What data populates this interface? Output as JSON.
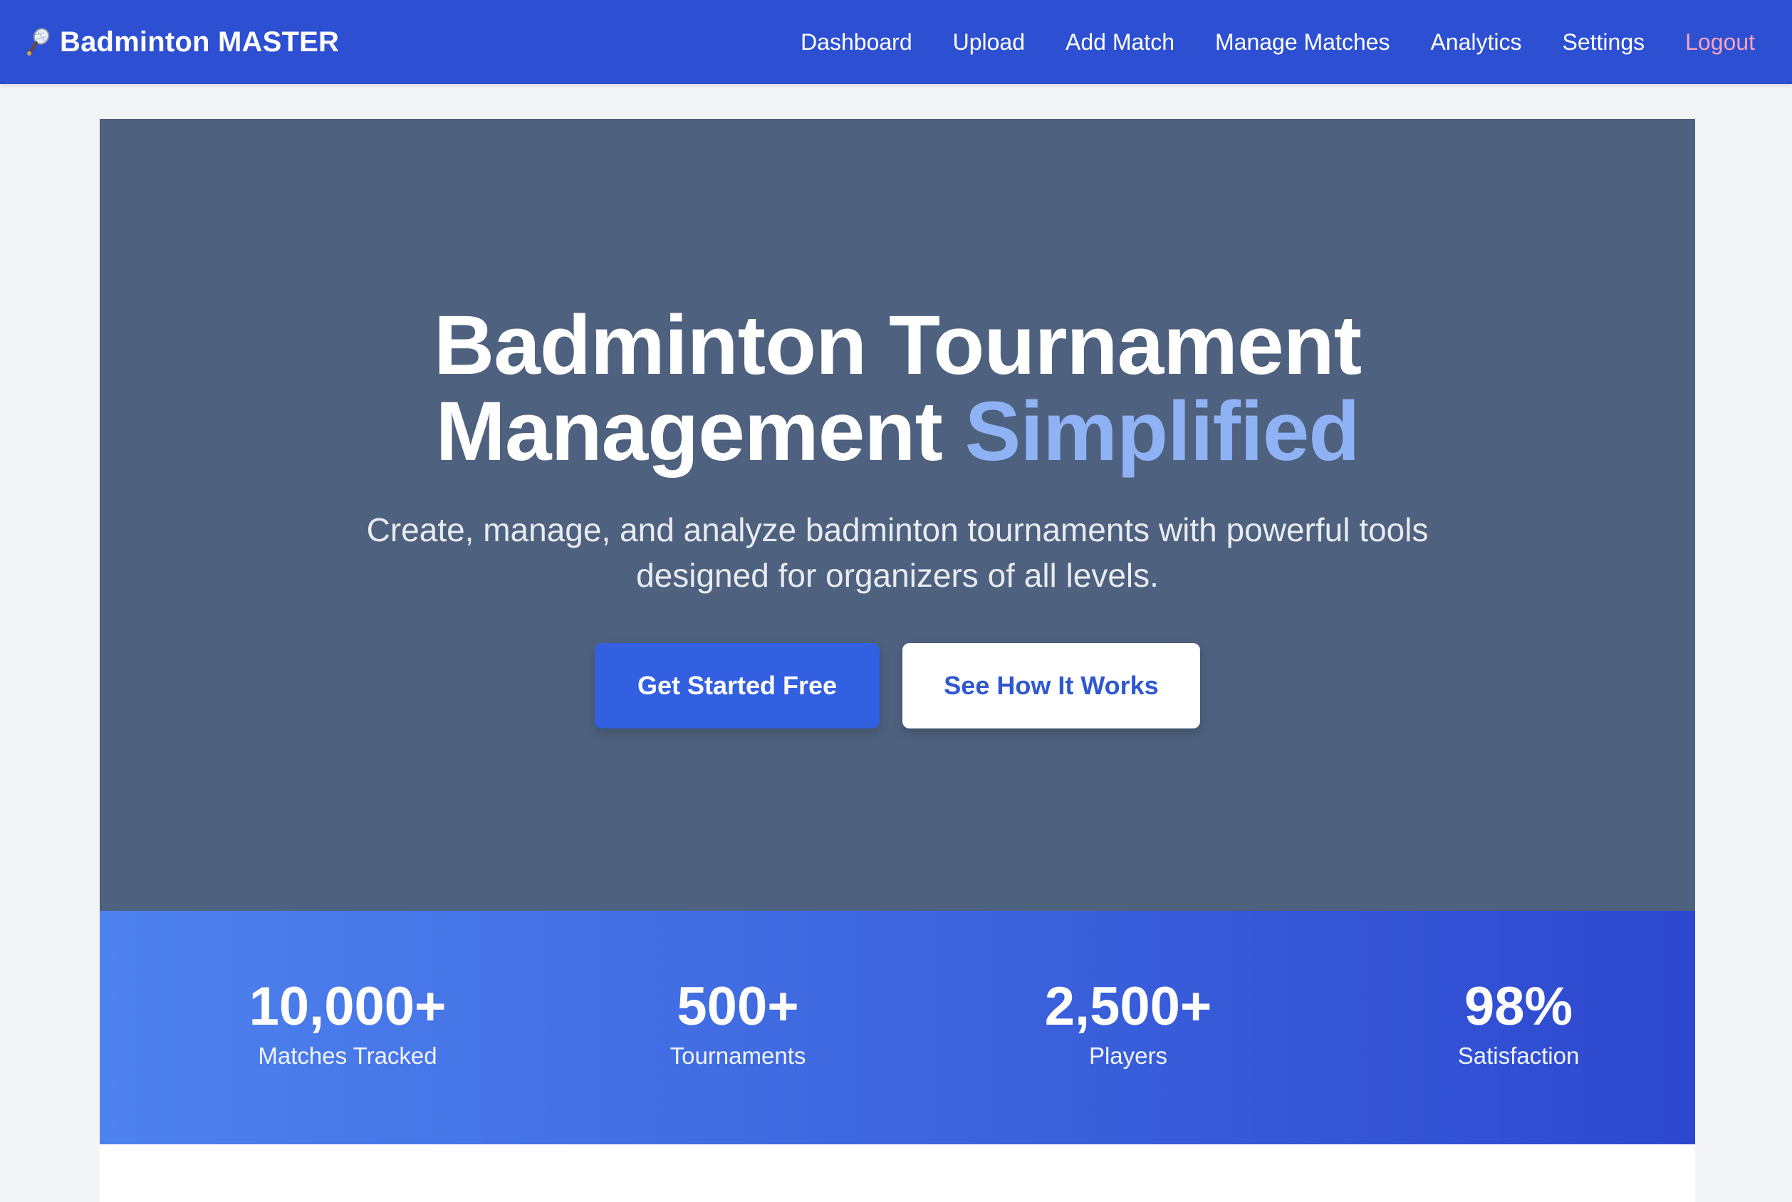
{
  "navbar": {
    "brand_icon": "badminton-racket-icon",
    "brand_name": "Badminton MASTER",
    "links": [
      {
        "label": "Dashboard"
      },
      {
        "label": "Upload"
      },
      {
        "label": "Add Match"
      },
      {
        "label": "Manage Matches"
      },
      {
        "label": "Analytics"
      },
      {
        "label": "Settings"
      },
      {
        "label": "Logout"
      }
    ]
  },
  "hero": {
    "title_line1": "Badminton Tournament",
    "title_line2_main": "Management ",
    "title_line2_accent": "Simplified",
    "subtitle": "Create, manage, and analyze badminton tournaments with powerful tools designed for organizers of all levels.",
    "primary_button": "Get Started Free",
    "secondary_button": "See How It Works"
  },
  "stats": [
    {
      "value": "10,000+",
      "label": "Matches Tracked"
    },
    {
      "value": "500+",
      "label": "Tournaments"
    },
    {
      "value": "2,500+",
      "label": "Players"
    },
    {
      "value": "98%",
      "label": "Satisfaction"
    }
  ],
  "colors": {
    "navbar_bg": "#2d4fd2",
    "hero_bg": "#4e617e",
    "accent_text": "#8fb2f5",
    "primary_button": "#3260e0",
    "logout_link": "#f5a3c0",
    "stats_gradient_start": "#4e82ee",
    "stats_gradient_end": "#2d48cf"
  }
}
